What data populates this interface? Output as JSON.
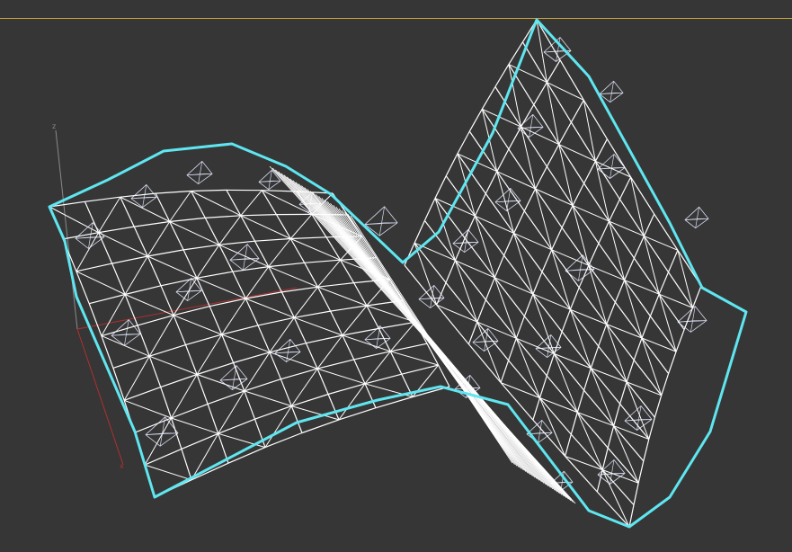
{
  "viewport": {
    "background": "#363636",
    "active_border_color": "#c8a23a"
  },
  "axis_tripod": {
    "z_label": "z",
    "x_label": "x",
    "x_color": "#b03030",
    "y_color": "#b03030",
    "z_color": "#8a8a8a"
  },
  "mesh": {
    "wire_color": "#ffffff",
    "selection_outline_color": "#5fe6f0",
    "cell_helper_color": "#d6dcf0",
    "icon": "wireframe-surface-icon"
  }
}
